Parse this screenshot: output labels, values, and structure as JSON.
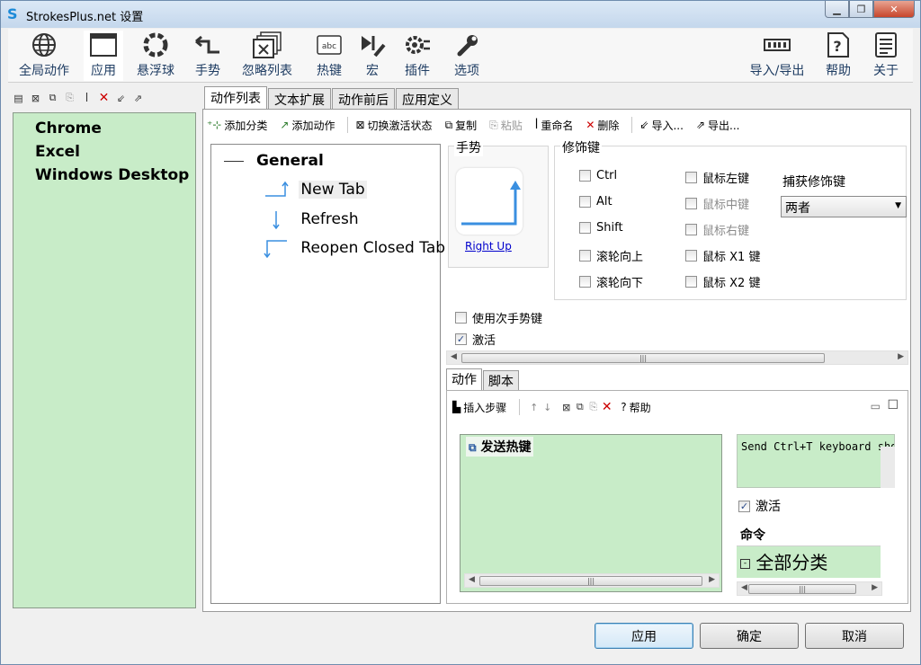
{
  "window": {
    "title": "StrokesPlus.net 设置"
  },
  "toolbar": {
    "global_actions": "全局动作",
    "apps": "应用",
    "floater": "悬浮球",
    "gestures": "手势",
    "ignore_list": "忽略列表",
    "hotkeys": "热键",
    "macros": "宏",
    "plugins": "插件",
    "options": "选项",
    "import_export": "导入/导出",
    "help": "帮助",
    "about": "关于"
  },
  "apps_list": [
    "Chrome",
    "Excel",
    "Windows Desktop"
  ],
  "tabs": [
    "动作列表",
    "文本扩展",
    "动作前后",
    "应用定义"
  ],
  "action_bar": {
    "add_category": "添加分类",
    "add_action": "添加动作",
    "toggle_active": "切换激活状态",
    "copy": "复制",
    "paste": "粘贴",
    "rename": "重命名",
    "delete": "删除",
    "import": "导入...",
    "export": "导出..."
  },
  "tree": {
    "category": "General",
    "items": [
      "New Tab",
      "Refresh",
      "Reopen Closed Tab"
    ]
  },
  "gesture": {
    "label": "手势",
    "name": "Right Up"
  },
  "modifiers": {
    "label": "修饰键",
    "ctrl": "Ctrl",
    "alt": "Alt",
    "shift": "Shift",
    "wheel_up": "滚轮向上",
    "wheel_down": "滚轮向下",
    "mouse_left": "鼠标左键",
    "mouse_middle": "鼠标中键",
    "mouse_right": "鼠标右键",
    "mouse_x1": "鼠标 X1 键",
    "mouse_x2": "鼠标 X2 键",
    "capture_label": "捕获修饰键",
    "capture_value": "两者"
  },
  "options": {
    "secondary_key": "使用次手势键",
    "active": "激活"
  },
  "subtabs": [
    "动作",
    "脚本"
  ],
  "step_bar": {
    "insert_step": "插入步骤",
    "help": "帮助"
  },
  "steps": {
    "item": "发送热键"
  },
  "step_detail": {
    "description": "Send Ctrl+T keyboard shortcut",
    "active": "激活",
    "command_label": "命令",
    "command_value": "全部分类"
  },
  "buttons": {
    "apply": "应用",
    "ok": "确定",
    "cancel": "取消"
  }
}
